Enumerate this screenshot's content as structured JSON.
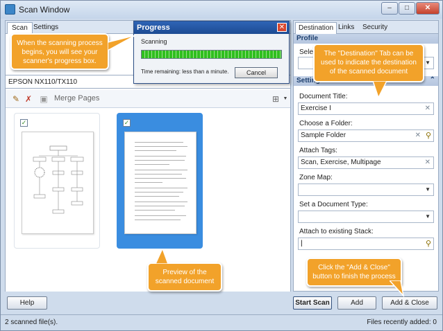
{
  "window": {
    "title": "Scan Window"
  },
  "left_tabs": [
    "Scan",
    "Settings"
  ],
  "scanner": {
    "name": "EPSON NX110/TX110"
  },
  "toolbar": {
    "merge_label": "Merge Pages"
  },
  "progress": {
    "title": "Progress",
    "label": "Scanning",
    "fraction": 1.0,
    "time_remaining": "Time remaining: less than a minute.",
    "cancel": "Cancel"
  },
  "right_tabs": [
    "Destination",
    "Links",
    "Security"
  ],
  "profile": {
    "header": "Profile",
    "select_label": "Select"
  },
  "settings": {
    "header": "Settings"
  },
  "fields": {
    "title_label": "Document Title:",
    "title_value": "Exercise I",
    "folder_label": "Choose a Folder:",
    "folder_value": "Sample Folder",
    "tags_label": "Attach Tags:",
    "tags_value": "Scan, Exercise, Multipage",
    "zone_label": "Zone Map:",
    "doctype_label": "Set a Document Type:",
    "stack_label": "Attach to existing Stack:"
  },
  "buttons": {
    "help": "Help",
    "start": "Start Scan",
    "add": "Add",
    "add_close": "Add & Close"
  },
  "status": {
    "left": "2 scanned file(s).",
    "right": "Files recently added: 0"
  },
  "callouts": {
    "progress_note": "When the scanning process begins, you will see your scanner's progress box.",
    "destination_note": "The \"Destination\" Tab can be used to indicate the destination of the scanned document",
    "preview_note": "Preview of the scanned document",
    "addclose_note": "Click the \"Add & Close\" button to finish the process"
  },
  "colors": {
    "callout": "#f2a22a",
    "progress_green": "#2fbf1f",
    "selected_page": "#3a8de0"
  }
}
